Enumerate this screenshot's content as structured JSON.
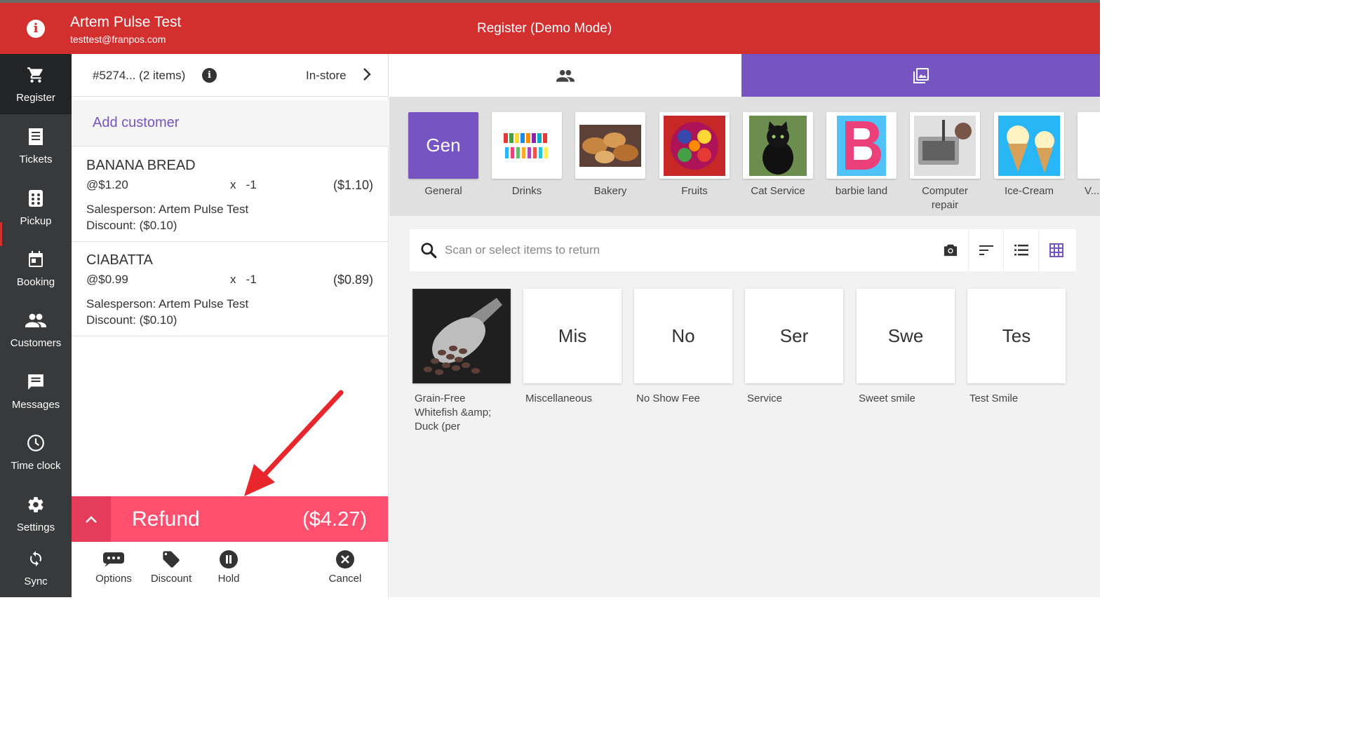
{
  "header": {
    "user_name": "Artem  Pulse Test",
    "user_email": "testtest@franpos.com",
    "title": "Register  (Demo Mode)",
    "info_icon": "info-icon"
  },
  "nav": {
    "items": [
      {
        "label": "Register",
        "icon": "cart-icon",
        "active": true
      },
      {
        "label": "Tickets",
        "icon": "receipt-icon"
      },
      {
        "label": "Pickup",
        "icon": "pickup-icon"
      },
      {
        "label": "Booking",
        "icon": "calendar-icon"
      },
      {
        "label": "Customers",
        "icon": "people-icon"
      },
      {
        "label": "Messages",
        "icon": "message-icon"
      },
      {
        "label": "Time clock",
        "icon": "clock-icon"
      },
      {
        "label": "Settings",
        "icon": "gear-icon"
      },
      {
        "label": "Sync",
        "icon": "sync-icon"
      }
    ]
  },
  "ticket": {
    "id": "#5274... (2 items)",
    "mode": "In-store",
    "add_customer": "Add customer",
    "items": [
      {
        "name": "BANANA BREAD",
        "unit_price": "@$1.20",
        "qty": "x   -1",
        "total": "($1.10)",
        "salesperson": "Salesperson: Artem Pulse Test",
        "discount": "Discount: ($0.10)"
      },
      {
        "name": "CIABATTA",
        "unit_price": "@$0.99",
        "qty": "x   -1",
        "total": "($0.89)",
        "salesperson": "Salesperson: Artem Pulse Test",
        "discount": "Discount: ($0.10)"
      }
    ],
    "refund_label": "Refund",
    "refund_total": "($4.27)",
    "actions": [
      {
        "label": "Options",
        "icon": "more-icon"
      },
      {
        "label": "Discount",
        "icon": "tag-icon"
      },
      {
        "label": "Hold",
        "icon": "pause-icon"
      },
      {
        "label": "Cancel",
        "icon": "cancel-icon"
      }
    ]
  },
  "categories": [
    {
      "label": "General",
      "tile_text": "Gen"
    },
    {
      "label": "Drinks"
    },
    {
      "label": "Bakery"
    },
    {
      "label": "Fruits"
    },
    {
      "label": "Cat Service"
    },
    {
      "label": "barbie land"
    },
    {
      "label": "Computer repair"
    },
    {
      "label": "Ice-Cream"
    },
    {
      "label": "V..."
    }
  ],
  "search": {
    "placeholder": "Scan or select items to return",
    "value": ""
  },
  "products": [
    {
      "label": "Grain-Free Whitefish &amp; Duck (per",
      "tile_text": ""
    },
    {
      "label": "Miscellaneous",
      "tile_text": "Mis"
    },
    {
      "label": "No Show Fee",
      "tile_text": "No"
    },
    {
      "label": "Service",
      "tile_text": "Ser"
    },
    {
      "label": "Sweet smile",
      "tile_text": "Swe"
    },
    {
      "label": "Test Smile",
      "tile_text": "Tes"
    }
  ],
  "colors": {
    "header": "#d32f2f",
    "accent": "#7654c1",
    "refund": "#ff4f6e",
    "nav": "#37393b"
  }
}
